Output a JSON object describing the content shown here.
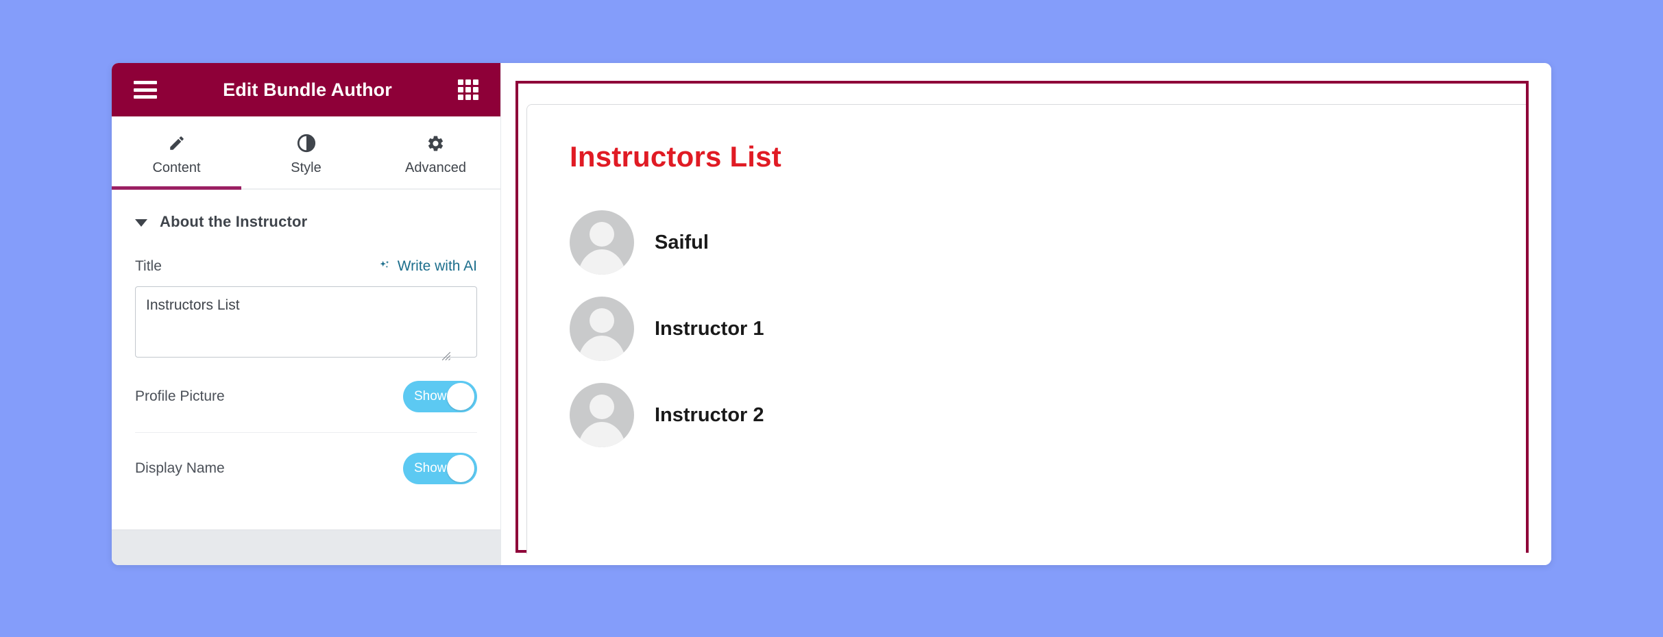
{
  "window": {
    "background_color": "#849dfa",
    "accent_color": "#8e0038"
  },
  "panel": {
    "header": {
      "title": "Edit Bundle Author",
      "menu_icon": "hamburger-icon",
      "apps_icon": "grid-apps-icon",
      "background_color": "#8e0038"
    },
    "tabs": [
      {
        "label": "Content",
        "icon": "pencil-icon",
        "active": true
      },
      {
        "label": "Style",
        "icon": "contrast-icon",
        "active": false
      },
      {
        "label": "Advanced",
        "icon": "gear-icon",
        "active": false
      }
    ],
    "active_tab_indicator_color": "#9b2063",
    "section": {
      "title": "About the Instructor",
      "caret_icon": "caret-down-icon",
      "expanded": true
    },
    "controls": {
      "title": {
        "label": "Title",
        "ai_link_label": "Write with AI",
        "ai_link_icon": "sparkles-icon",
        "ai_link_color": "#1c6e8c",
        "value": "Instructors List",
        "placeholder": ""
      },
      "profile_picture": {
        "label": "Profile Picture",
        "toggle_value": "Show",
        "toggle_on": true,
        "toggle_color": "#5cc9f2"
      },
      "display_name": {
        "label": "Display Name",
        "toggle_value": "Show",
        "toggle_on": true,
        "toggle_color": "#5cc9f2"
      }
    }
  },
  "preview": {
    "widget_outline_color": "#8e0038",
    "heading": "Instructors List",
    "heading_color": "#e01b24",
    "instructors": [
      {
        "name": "Saiful",
        "avatar_icon": "user-placeholder-avatar-icon"
      },
      {
        "name": "Instructor 1",
        "avatar_icon": "user-placeholder-avatar-icon"
      },
      {
        "name": "Instructor 2",
        "avatar_icon": "user-placeholder-avatar-icon"
      }
    ]
  }
}
